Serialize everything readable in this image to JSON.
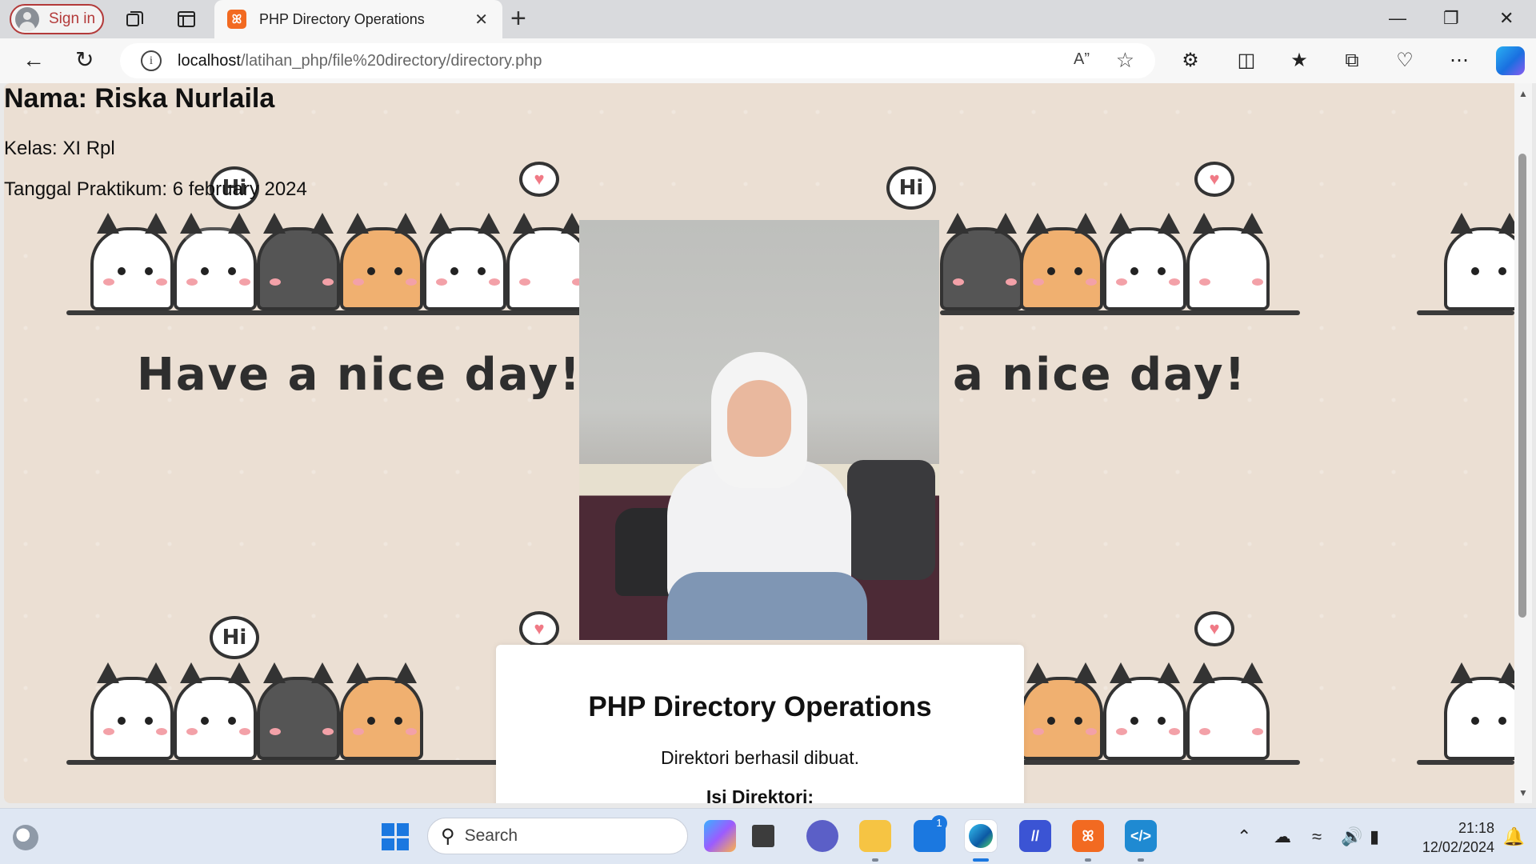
{
  "browser": {
    "signin_label": "Sign in",
    "tab_title": "PHP Directory Operations",
    "tab_favicon_label": "ꕤ",
    "close_tab": "✕",
    "new_tab": "+",
    "url_host": "localhost",
    "url_path": "/latihan_php/file%20directory/directory.php",
    "window_controls": {
      "minimize": "—",
      "restore": "❐",
      "close": "✕"
    }
  },
  "page": {
    "nama": "Nama: Riska Nurlaila",
    "kelas": "Kelas: XI Rpl",
    "tanggal": "Tanggal Praktikum: 6 february 2024",
    "card": {
      "heading": "PHP Directory Operations",
      "message": "Direktori berhasil dibuat.",
      "isi": "Isi Direktori:"
    },
    "wallpaper": {
      "text": "Have a nice day!",
      "bubble_text": "Hi",
      "heart": "♥"
    }
  },
  "taskbar": {
    "search_placeholder": "Search",
    "store_badge": "1",
    "time": "21:18",
    "date": "12/02/2024"
  }
}
